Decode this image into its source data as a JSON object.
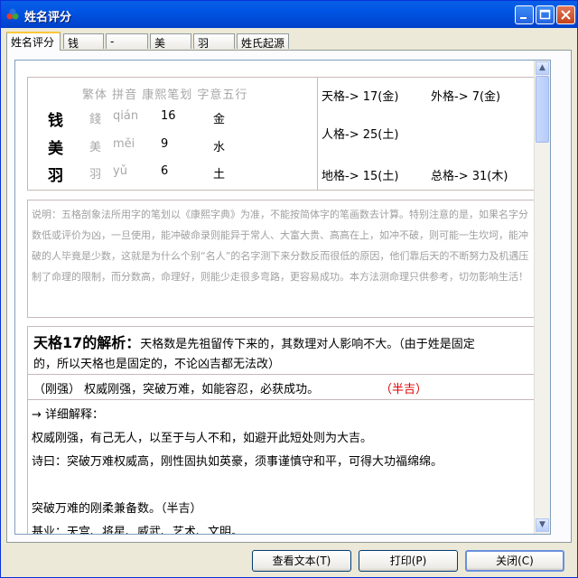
{
  "window": {
    "title": "姓名评分"
  },
  "tabs": [
    "姓名评分",
    "钱",
    "-",
    "美",
    "羽",
    "姓氏起源"
  ],
  "table": {
    "header": "繁体 拼音 康熙笔划 字意五行",
    "rows": [
      {
        "char": "钱",
        "trad": "錢",
        "pinyin": "qián",
        "strokes": "16",
        "wuxing": "金"
      },
      {
        "char": "美",
        "trad": "美",
        "pinyin": "měi",
        "strokes": "9",
        "wuxing": "水"
      },
      {
        "char": "羽",
        "trad": "羽",
        "pinyin": "yǔ",
        "strokes": "6",
        "wuxing": "土"
      }
    ]
  },
  "grids": {
    "tiange": "天格-> 17(金)",
    "waige": "外格-> 7(金)",
    "renge": "人格-> 25(土)",
    "dige": "地格-> 15(土)",
    "zongge": "总格-> 31(木)"
  },
  "note": "说明：五格剖象法所用字的笔划以《康熙字典》为准，不能按简体字的笔画数去计算。特别注意的是，如果名字分数低或评价为凶，一旦使用，能冲破命录则能异于常人、大富大贵、高高在上，如冲不破，则可能一生坎坷，能冲破的人毕竟是少数，这就是为什么个别“名人”的名字测下来分数反而很低的原因，他们靠后天的不断努力及机遇压制了命理的限制，而分数高，命理好，则能少走很多弯路，更容易成功。本方法测命理只供参考，切勿影响生活！",
  "analysis": {
    "heading": "天格17的解析：",
    "intro_1": "天格数是先祖留传下来的，其数理对人影响不大。（由于姓是固定",
    "intro_2": "的，所以天格也是固定的，不论凶吉都无法改）",
    "summary": "（刚强） 权威刚强，突破万难，如能容忍，必获成功。",
    "rating": "（半吉）",
    "detail_label": "→ 详细解释：",
    "line1": "权威刚强，有己无人，以至于与人不和，如避开此短处则为大吉。",
    "line2": "诗曰：突破万难权威高，刚性固执如英豪，须事谨慎守和平，可得大功福绵绵。",
    "line3": "突破万难的刚柔兼备数。（半吉）",
    "line4": "基业：天宫、将星、威武、艺术、文明。"
  },
  "buttons": {
    "view_text": "查看文本(T)",
    "print": "打印(P)",
    "close": "关闭(C)"
  },
  "colors": {
    "rating": "#e00000",
    "titlebar": "#0054e3"
  }
}
